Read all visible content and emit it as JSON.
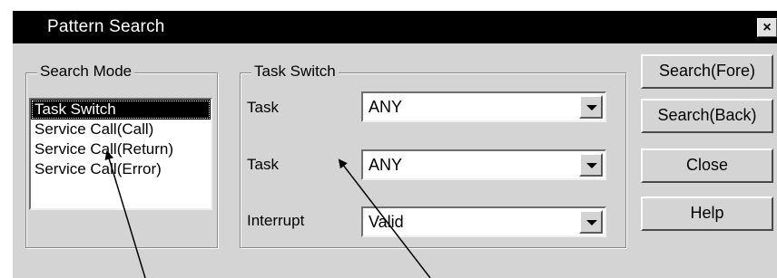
{
  "window": {
    "title": "Pattern Search",
    "close_glyph": "×"
  },
  "search_mode": {
    "legend": "Search Mode",
    "items": [
      {
        "label": "Task Switch",
        "selected": true
      },
      {
        "label": "Service Call(Call)",
        "selected": false
      },
      {
        "label": "Service Call(Return)",
        "selected": false
      },
      {
        "label": "Service Call(Error)",
        "selected": false
      }
    ]
  },
  "task_switch": {
    "legend": "Task Switch",
    "fields": [
      {
        "label": "Task",
        "value": "ANY"
      },
      {
        "label": "Task",
        "value": "ANY"
      },
      {
        "label": "Interrupt",
        "value": "Valid"
      }
    ]
  },
  "buttons": {
    "search_fore": "Search(Fore)",
    "search_back": "Search(Back)",
    "close": "Close",
    "help": "Help"
  },
  "colors": {
    "titlebar": "#000000",
    "dialog_face": "#d4d4d4",
    "selection": "#000000"
  },
  "icons": {
    "close": "close-icon",
    "dropdown": "chevron-down-icon"
  }
}
